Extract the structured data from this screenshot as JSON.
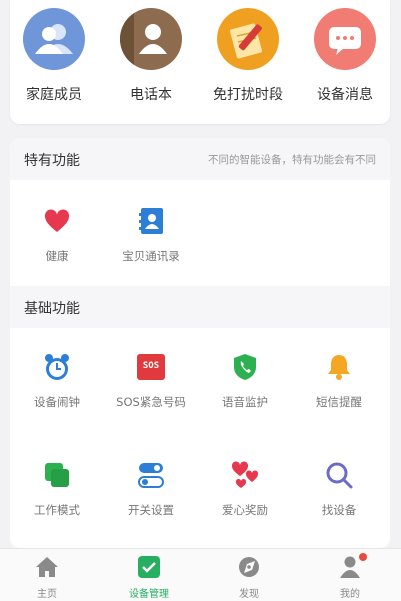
{
  "quick_actions": [
    {
      "label": "家庭成员",
      "icon": "family-members-icon"
    },
    {
      "label": "电话本",
      "icon": "phonebook-icon"
    },
    {
      "label": "免打扰时段",
      "icon": "do-not-disturb-icon"
    },
    {
      "label": "设备消息",
      "icon": "device-message-icon"
    }
  ],
  "special_section": {
    "title": "特有功能",
    "hint": "不同的智能设备，特有功能会有不同",
    "items": [
      {
        "label": "健康",
        "icon": "heart-icon"
      },
      {
        "label": "宝贝通讯录",
        "icon": "contacts-book-icon"
      }
    ]
  },
  "basic_section": {
    "title": "基础功能",
    "items": [
      {
        "label": "设备闹钟",
        "icon": "alarm-clock-icon"
      },
      {
        "label": "SOS紧急号码",
        "icon": "sos-icon"
      },
      {
        "label": "语音监护",
        "icon": "voice-monitor-icon"
      },
      {
        "label": "短信提醒",
        "icon": "bell-icon"
      },
      {
        "label": "工作模式",
        "icon": "work-mode-icon"
      },
      {
        "label": "开关设置",
        "icon": "toggle-settings-icon"
      },
      {
        "label": "爱心奖励",
        "icon": "love-hearts-icon"
      },
      {
        "label": "找设备",
        "icon": "find-device-search-icon"
      }
    ]
  },
  "sos_badge_text": "SOS",
  "tabbar": [
    {
      "label": "主页",
      "icon": "home-icon"
    },
    {
      "label": "设备管理",
      "icon": "device-manage-icon"
    },
    {
      "label": "发现",
      "icon": "discover-icon"
    },
    {
      "label": "我的",
      "icon": "profile-icon"
    }
  ],
  "colors": {
    "active_tab": "#27ae60",
    "family": "#6f96d8",
    "phonebook": "#8d6b4e",
    "dnd": "#f0a020",
    "message": "#f07c74",
    "heart": "#e63950",
    "blue": "#2d7fd6",
    "sos_red": "#e0393e",
    "green": "#2db150",
    "bell": "#f5a623",
    "search": "#6c6cc8"
  }
}
